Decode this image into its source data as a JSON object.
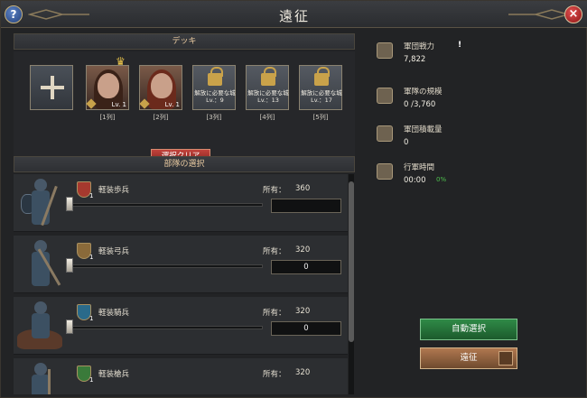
{
  "window": {
    "title": "遠征",
    "help_icon": "?",
    "close_icon": "×"
  },
  "deck": {
    "header": "デッキ",
    "slots": [
      {
        "type": "add",
        "label": ""
      },
      {
        "type": "hero",
        "level": "Lv. 1",
        "label": "[1列]"
      },
      {
        "type": "hero",
        "level": "Lv. 1",
        "label": "[2列]"
      },
      {
        "type": "locked",
        "lock_text": "解放に必要な城Lv.：9",
        "label": "[3列]"
      },
      {
        "type": "locked",
        "lock_text": "解放に必要な城Lv.：13",
        "label": "[4列]"
      },
      {
        "type": "locked",
        "lock_text": "解放に必要な城Lv.：17",
        "label": "[5列]"
      }
    ],
    "clear_button": "選択クリア"
  },
  "troops": {
    "header": "部隊の選択",
    "owned_label": "所有：",
    "rows": [
      {
        "name": "軽装歩兵",
        "tier": "1",
        "owned": "360",
        "qty": "",
        "badge_color": "red"
      },
      {
        "name": "軽装弓兵",
        "tier": "1",
        "owned": "320",
        "qty": "0",
        "badge_color": "tan"
      },
      {
        "name": "軽装騎兵",
        "tier": "1",
        "owned": "320",
        "qty": "0",
        "badge_color": "blue"
      },
      {
        "name": "軽装槍兵",
        "tier": "1",
        "owned": "320",
        "qty": "",
        "badge_color": "green"
      }
    ]
  },
  "stats": {
    "power": {
      "label": "軍団戦力",
      "value": "7,822",
      "info": "!"
    },
    "scale": {
      "label": "軍隊の規模",
      "value": "0 /3,760"
    },
    "load": {
      "label": "軍団積載量",
      "value": "0"
    },
    "march_time": {
      "label": "行軍時間",
      "value": "00:00",
      "extra": "0%"
    }
  },
  "buttons": {
    "auto_select": "自動選択",
    "march": "遠征"
  },
  "colors": {
    "accent_red": "#a6392e",
    "accent_green": "#2f8a47",
    "accent_gold": "#c9a24a"
  }
}
